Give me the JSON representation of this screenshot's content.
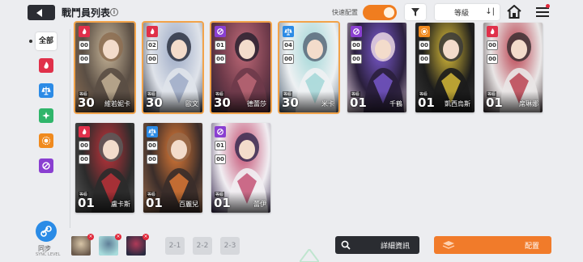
{
  "header": {
    "title": "戰鬥員列表",
    "info": "i",
    "quick_label": "快速配置",
    "sort_label": "等級",
    "sort_icon": "↓|"
  },
  "sidebar": {
    "all_label": "全部",
    "filters": [
      {
        "icon": "fire-element-icon",
        "color": "#e0304a"
      },
      {
        "icon": "balance-element-icon",
        "color": "#2c8be6"
      },
      {
        "icon": "wind-element-icon",
        "color": "#2fb56a"
      },
      {
        "icon": "sun-element-icon",
        "color": "#f08a1e"
      },
      {
        "icon": "void-element-icon",
        "color": "#8a3fd1"
      }
    ],
    "sync_label": "同步",
    "sync_sub": "SYNC LEVEL"
  },
  "cards": [
    {
      "name": "維若妮卡",
      "level": "30",
      "badges": [
        "00",
        "00"
      ],
      "element": "fire",
      "selected": "orange",
      "art": [
        "#5a4e44",
        "#c9b79a",
        "#8d6f52"
      ]
    },
    {
      "name": "歐文",
      "level": "30",
      "badges": [
        "02",
        "00"
      ],
      "element": "fire",
      "selected": "orange",
      "art": [
        "#dfe3ea",
        "#9aa8c4",
        "#2d3342"
      ]
    },
    {
      "name": "德蕾莎",
      "level": "30",
      "badges": [
        "01",
        "00"
      ],
      "element": "void",
      "selected": "orange",
      "art": [
        "#6e3a4a",
        "#c06a78",
        "#2a2230"
      ]
    },
    {
      "name": "米卡",
      "level": "30",
      "badges": [
        "04",
        "00"
      ],
      "element": "balance",
      "selected": "orange",
      "art": [
        "#eef1f3",
        "#9fd6d6",
        "#5a6a7a"
      ]
    },
    {
      "name": "千鶴",
      "level": "01",
      "badges": [
        "00",
        "00"
      ],
      "element": "void",
      "selected": "",
      "art": [
        "#2a1f3c",
        "#7b5ad1",
        "#e9d6e2"
      ]
    },
    {
      "name": "凱西烏斯",
      "level": "01",
      "badges": [
        "00",
        "00"
      ],
      "element": "sun",
      "selected": "",
      "art": [
        "#1c1c1c",
        "#e0c23a",
        "#3a3a3a"
      ]
    },
    {
      "name": "席琳娜",
      "level": "01",
      "badges": [
        "00",
        "00"
      ],
      "element": "fire",
      "selected": "",
      "art": [
        "#e9e6e6",
        "#b83a48",
        "#3d3033"
      ]
    },
    {
      "name": "盧卡斯",
      "level": "01",
      "badges": [
        "00",
        "00"
      ],
      "element": "fire",
      "selected": "",
      "art": [
        "#2b2b2b",
        "#c4323a",
        "#5b5b5b"
      ]
    },
    {
      "name": "百麗兒",
      "level": "01",
      "badges": [
        "00",
        "00"
      ],
      "element": "balance",
      "selected": "",
      "art": [
        "#3a2d2a",
        "#e37c36",
        "#9a6b4a"
      ]
    },
    {
      "name": "蕾伊",
      "level": "01",
      "badges": [
        "01",
        "00"
      ],
      "element": "void",
      "selected": "",
      "art": [
        "#f1eef2",
        "#c24a6e",
        "#3b2e52"
      ]
    }
  ],
  "lvl_tag": "等級",
  "bottom": {
    "team_slots": [
      {
        "art": [
          "#6a5a4c",
          "#d8c6a8"
        ]
      },
      {
        "art": [
          "#a8dcdc",
          "#5f7f98"
        ]
      },
      {
        "art": [
          "#2a2a40",
          "#b03a58"
        ]
      }
    ],
    "team_x": "×",
    "teams": [
      "2-1",
      "2-2",
      "2-3"
    ],
    "detail_label": "詳細資訊",
    "deploy_label": "配置"
  },
  "colors": {
    "accent": "#f17b2a",
    "dark": "#2a2c31",
    "fire": "#e0304a",
    "balance": "#2c8be6",
    "void": "#8a3fd1",
    "sun": "#f08a1e"
  }
}
